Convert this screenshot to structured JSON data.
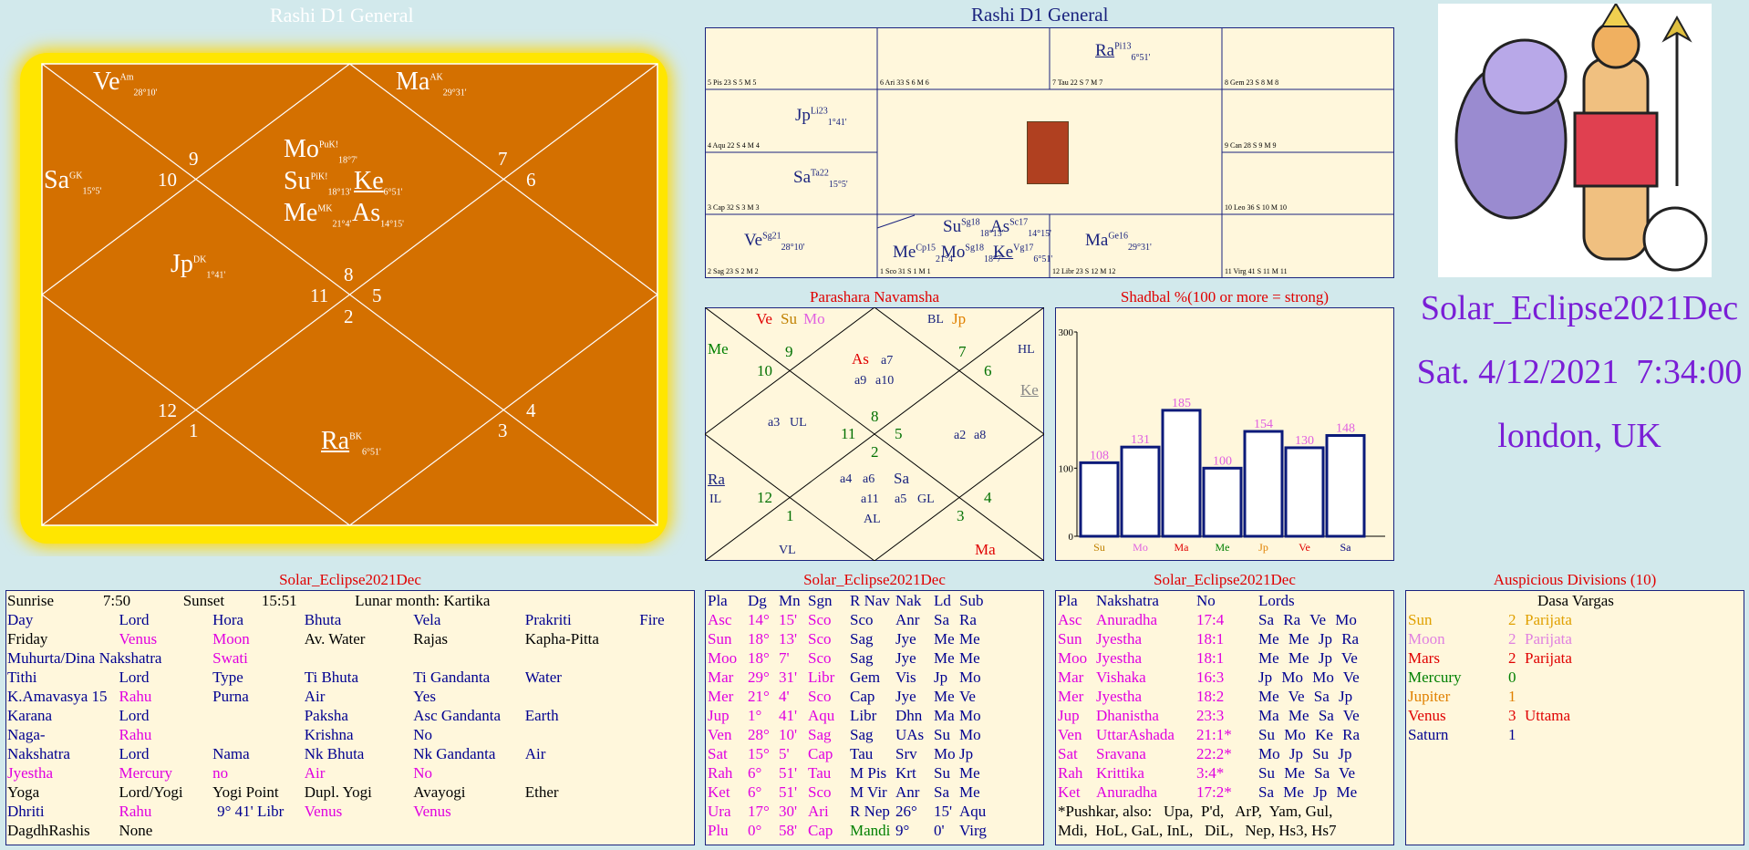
{
  "main_chart": {
    "title": "Rashi D1 General",
    "planets": [
      {
        "abbr": "Ve",
        "sup": "Am",
        "sub": "28°10'"
      },
      {
        "abbr": "Ma",
        "sup": "AK",
        "sub": "29°31'"
      },
      {
        "abbr": "Sa",
        "sup": "GK",
        "sub": "15°5'"
      },
      {
        "abbr": "Mo",
        "sup": "PuK!",
        "sub": "18°7'"
      },
      {
        "abbr": "Su",
        "sup": "PiK!",
        "sub": "18°13'"
      },
      {
        "abbr": "Ke",
        "sup": "",
        "sub": "6°51'"
      },
      {
        "abbr": "Me",
        "sup": "MK",
        "sub": "21°4'"
      },
      {
        "abbr": "As",
        "sup": "",
        "sub": "14°15'"
      },
      {
        "abbr": "Jp",
        "sup": "DK",
        "sub": "1°41'"
      },
      {
        "abbr": "Ra",
        "sup": "BK",
        "sub": "6°51'"
      }
    ],
    "house_numbers": [
      "9",
      "10",
      "7",
      "6",
      "8",
      "11",
      "5",
      "2",
      "12",
      "1",
      "3",
      "4"
    ]
  },
  "south_chart": {
    "title": "Rashi D1 General",
    "cells": [
      "5 Pis 23 S 5 M 5",
      "6 Ari 33 S 6 M 6",
      "7 Tau 22 S 7 M 7",
      "8 Gem 23 S 8 M 8",
      "4 Aqu 22 S 4 M 4",
      "9 Can 28 S 9 M 9",
      "3 Cap 32 S 3 M 3",
      "10 Leo 36 S 10 M 10",
      "2 Sag 23 S 2 M 2",
      "1 Sco 31 S 1 M 1",
      "12 Libr 23 S 12 M 12",
      "11 Virg 41 S 11 M 11"
    ],
    "planets": [
      {
        "abbr": "Ra",
        "sup": "Pi13",
        "sub": "6°51'"
      },
      {
        "abbr": "Jp",
        "sup": "Li23",
        "sub": "1°41'"
      },
      {
        "abbr": "Sa",
        "sup": "Ta22",
        "sub": "15°5'"
      },
      {
        "abbr": "Ve",
        "sup": "Sg21",
        "sub": "28°10'"
      },
      {
        "abbr": "Su",
        "sup": "Sg18",
        "sub": "18°13'"
      },
      {
        "abbr": "As",
        "sup": "Sc17",
        "sub": "14°15'"
      },
      {
        "abbr": "Me",
        "sup": "Cp15",
        "sub": "21°4'"
      },
      {
        "abbr": "Mo",
        "sup": "Sg18",
        "sub": "18°7'"
      },
      {
        "abbr": "Ke",
        "sup": "Vg17",
        "sub": "6°51'"
      },
      {
        "abbr": "Ma",
        "sup": "Ge16",
        "sub": "29°31'"
      }
    ]
  },
  "navamsa": {
    "title": "Parashara Navamsha",
    "labels": [
      "Ve",
      "Su",
      "Mo",
      "BL",
      "Jp",
      "Me",
      "HL",
      "Ke",
      "As",
      "a7",
      "a9",
      "a10",
      "a3",
      "UL",
      "Ra",
      "IL",
      "a4",
      "a6",
      "Sa",
      "a11",
      "a5",
      "GL",
      "AL",
      "a2",
      "a8",
      "VL",
      "Ma"
    ],
    "house_numbers": [
      "9",
      "10",
      "7",
      "6",
      "8",
      "11",
      "5",
      "2",
      "12",
      "1",
      "3",
      "4"
    ]
  },
  "shadbal": {
    "title": "Shadbal %(100 or more = strong)",
    "chart_data": {
      "type": "bar",
      "categories": [
        "Su",
        "Mo",
        "Ma",
        "Me",
        "Jp",
        "Ve",
        "Sa"
      ],
      "values": [
        108,
        131,
        185,
        100,
        154,
        130,
        148
      ],
      "yticks": [
        "300",
        "100",
        "0"
      ],
      "ylim": [
        0,
        300
      ]
    },
    "cat_colors": [
      "#c08000",
      "#e060e0",
      "#e00000",
      "#008000",
      "#e08000",
      "#e00000",
      "#000080"
    ]
  },
  "event": {
    "name": "Solar_Eclipse2021Dec",
    "datetime": "Sat. 4/12/2021  7:34:00",
    "place": "london, UK"
  },
  "panchang": {
    "title": "Solar_Eclipse2021Dec",
    "rows": [
      [
        "Sunrise",
        "7:50",
        "Sunset",
        "15:51",
        "Lunar month: Kartika",
        "",
        ""
      ],
      [
        "Day",
        "Lord",
        "Hora",
        "Bhuta",
        "Vela",
        "Prakriti",
        "Fire"
      ],
      [
        "Friday",
        "Venus",
        "Moon",
        "Av. Water",
        "Rajas",
        "Kapha-Pitta",
        ""
      ],
      [
        "Muhurta/Dina Nakshatra",
        "",
        "Swati",
        "",
        "",
        "",
        ""
      ],
      [
        "Tithi",
        "Lord",
        "Type",
        "Ti Bhuta",
        "Ti Gandanta",
        "Water",
        ""
      ],
      [
        "K.Amavasya 15",
        "Rahu",
        "Purna",
        "Air",
        "Yes",
        "",
        ""
      ],
      [
        "Karana",
        "Lord",
        "",
        "Paksha",
        "Asc Gandanta",
        "Earth",
        ""
      ],
      [
        "Naga-",
        "Rahu",
        "",
        "Krishna",
        "No",
        "",
        ""
      ],
      [
        "Nakshatra",
        "Lord",
        "Nama",
        "Nk Bhuta",
        "Nk Gandanta",
        "Air",
        ""
      ],
      [
        "Jyestha",
        "Mercury",
        "no",
        "Air",
        "No",
        "",
        ""
      ],
      [
        "Yoga",
        "Lord/Yogi",
        "Yogi Point",
        "Dupl. Yogi",
        "Avayogi",
        "Ether",
        ""
      ],
      [
        "Dhriti",
        "Rahu",
        "9° 41' Libr",
        "Venus",
        "Venus",
        "",
        ""
      ],
      [
        "DagdhRashis",
        "None",
        "",
        "",
        "",
        "",
        ""
      ]
    ]
  },
  "positions": {
    "title": "Solar_Eclipse2021Dec",
    "header": [
      "Pla",
      "Dg",
      "Mn",
      "Sgn",
      "R Nav",
      "Nak",
      "Ld",
      "Sub"
    ],
    "rows": [
      [
        "Asc",
        "14°",
        "15'",
        "Sco",
        "Sco",
        "Anr",
        "Sa",
        "Ra"
      ],
      [
        "Sun",
        "18°",
        "13'",
        "Sco",
        "Sag",
        "Jye",
        "Me",
        "Me"
      ],
      [
        "Moo",
        "18°",
        "7'",
        "Sco",
        "Sag",
        "Jye",
        "Me",
        "Me"
      ],
      [
        "Mar",
        "29°",
        "31'",
        "Libr",
        "Gem",
        "Vis",
        "Jp",
        "Mo"
      ],
      [
        "Mer",
        "21°",
        "4'",
        "Sco",
        "Cap",
        "Jye",
        "Me",
        "Ve"
      ],
      [
        "Jup",
        "1°",
        "41'",
        "Aqu",
        "Libr",
        "Dhn",
        "Ma",
        "Mo"
      ],
      [
        "Ven",
        "28°",
        "10'",
        "Sag",
        "Sag",
        "UAs",
        "Su",
        "Mo"
      ],
      [
        "Sat",
        "15°",
        "5'",
        "Cap",
        "Tau",
        "Srv",
        "Mo",
        "Jp"
      ],
      [
        "Rah",
        "6°",
        "51'",
        "Tau",
        "M Pis",
        "Krt",
        "Su",
        "Me"
      ],
      [
        "Ket",
        "6°",
        "51'",
        "Sco",
        "M Vir",
        "Anr",
        "Sa",
        "Me"
      ],
      [
        "Ura",
        "17°",
        "30'",
        "Ari",
        "R Nep",
        "26°",
        "15'",
        "Aqu"
      ],
      [
        "Plu",
        "0°",
        "58'",
        "Cap",
        "Mandi",
        "9°",
        "0'",
        "Virg"
      ]
    ]
  },
  "nakshatras": {
    "title": "Solar_Eclipse2021Dec",
    "header": [
      "Pla",
      "Nakshatra",
      "No",
      "Lords"
    ],
    "rows": [
      [
        "Asc",
        "Anuradha",
        "17:4",
        "Sa Ra Ve Mo"
      ],
      [
        "Sun",
        "Jyestha",
        "18:1",
        "Me Me Jp Ra"
      ],
      [
        "Moo",
        "Jyestha",
        "18:1",
        "Me Me Jp Ve"
      ],
      [
        "Mar",
        "Vishaka",
        "16:3",
        "Jp Mo Mo Ve"
      ],
      [
        "Mer",
        "Jyestha",
        "18:2",
        "Me Ve Sa Jp"
      ],
      [
        "Jup",
        "Dhanistha",
        "23:3",
        "Ma Me Sa Ve"
      ],
      [
        "Ven",
        "UttarAshada",
        "21:1*",
        "Su Mo Ke Ra"
      ],
      [
        "Sat",
        "Sravana",
        "22:2*",
        "Mo Jp Su Jp"
      ],
      [
        "Rah",
        "Krittika",
        "3:4*",
        "Su Me Sa Ve"
      ],
      [
        "Ket",
        "Anuradha",
        "17:2*",
        "Sa Me Jp Me"
      ]
    ],
    "footer1": "*Pushkar, also:   Upa,  P'd,   ArP,  Yam, Gul,",
    "footer2": "Mdi,  HoL, GaL, InL,   DiL,   Nep, Hs3, Hs7"
  },
  "auspicious": {
    "title": "Auspicious Divisions (10)",
    "header": "Dasa Vargas",
    "rows": [
      [
        "Sun",
        "2",
        "Parijata"
      ],
      [
        "Moon",
        "2",
        "Parijata"
      ],
      [
        "Mars",
        "2",
        "Parijata"
      ],
      [
        "Mercury",
        "0",
        ""
      ],
      [
        "Jupiter",
        "1",
        ""
      ],
      [
        "Venus",
        "3",
        "Uttama"
      ],
      [
        "Saturn",
        "1",
        ""
      ]
    ]
  }
}
